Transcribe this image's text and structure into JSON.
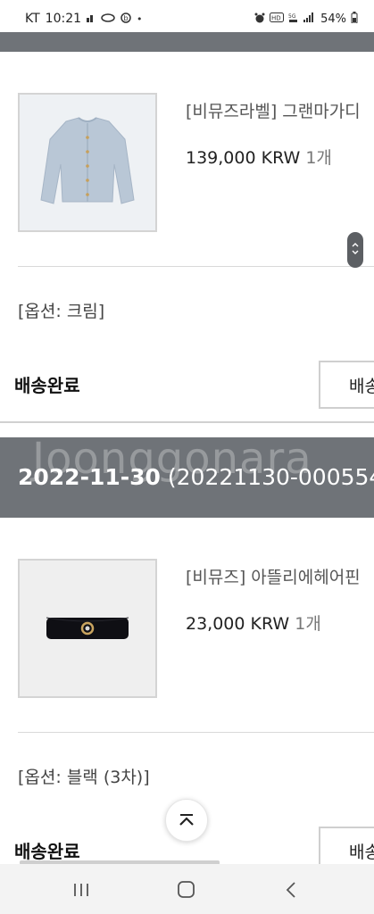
{
  "status_bar": {
    "carrier": "KT",
    "time": "10:21",
    "battery": "54%"
  },
  "orders": [
    {
      "item": {
        "name": "[비뮤즈라벨] 그랜마가디",
        "price": "139,000 KRW",
        "qty": "1개",
        "option": "[옵션: 크림]",
        "status": "배송완료",
        "action_label": "배송"
      }
    },
    {
      "date": "2022-11-30",
      "order_no": "(20221130-000554",
      "item": {
        "name": "[비뮤즈] 아뜰리에헤어핀",
        "price": "23,000 KRW",
        "qty": "1개",
        "option": "[옵션: 블랙 (3차)]",
        "status": "배송완료",
        "action_label": "배송"
      }
    }
  ],
  "watermark": "Joonggonara",
  "colors": {
    "header_bar": "#6f7378",
    "divider": "#d9d9d9"
  },
  "icons": {
    "scroll_up": "chevron-up-icon",
    "nav_recent": "recent-apps-icon",
    "nav_home": "home-icon",
    "nav_back": "back-icon"
  }
}
